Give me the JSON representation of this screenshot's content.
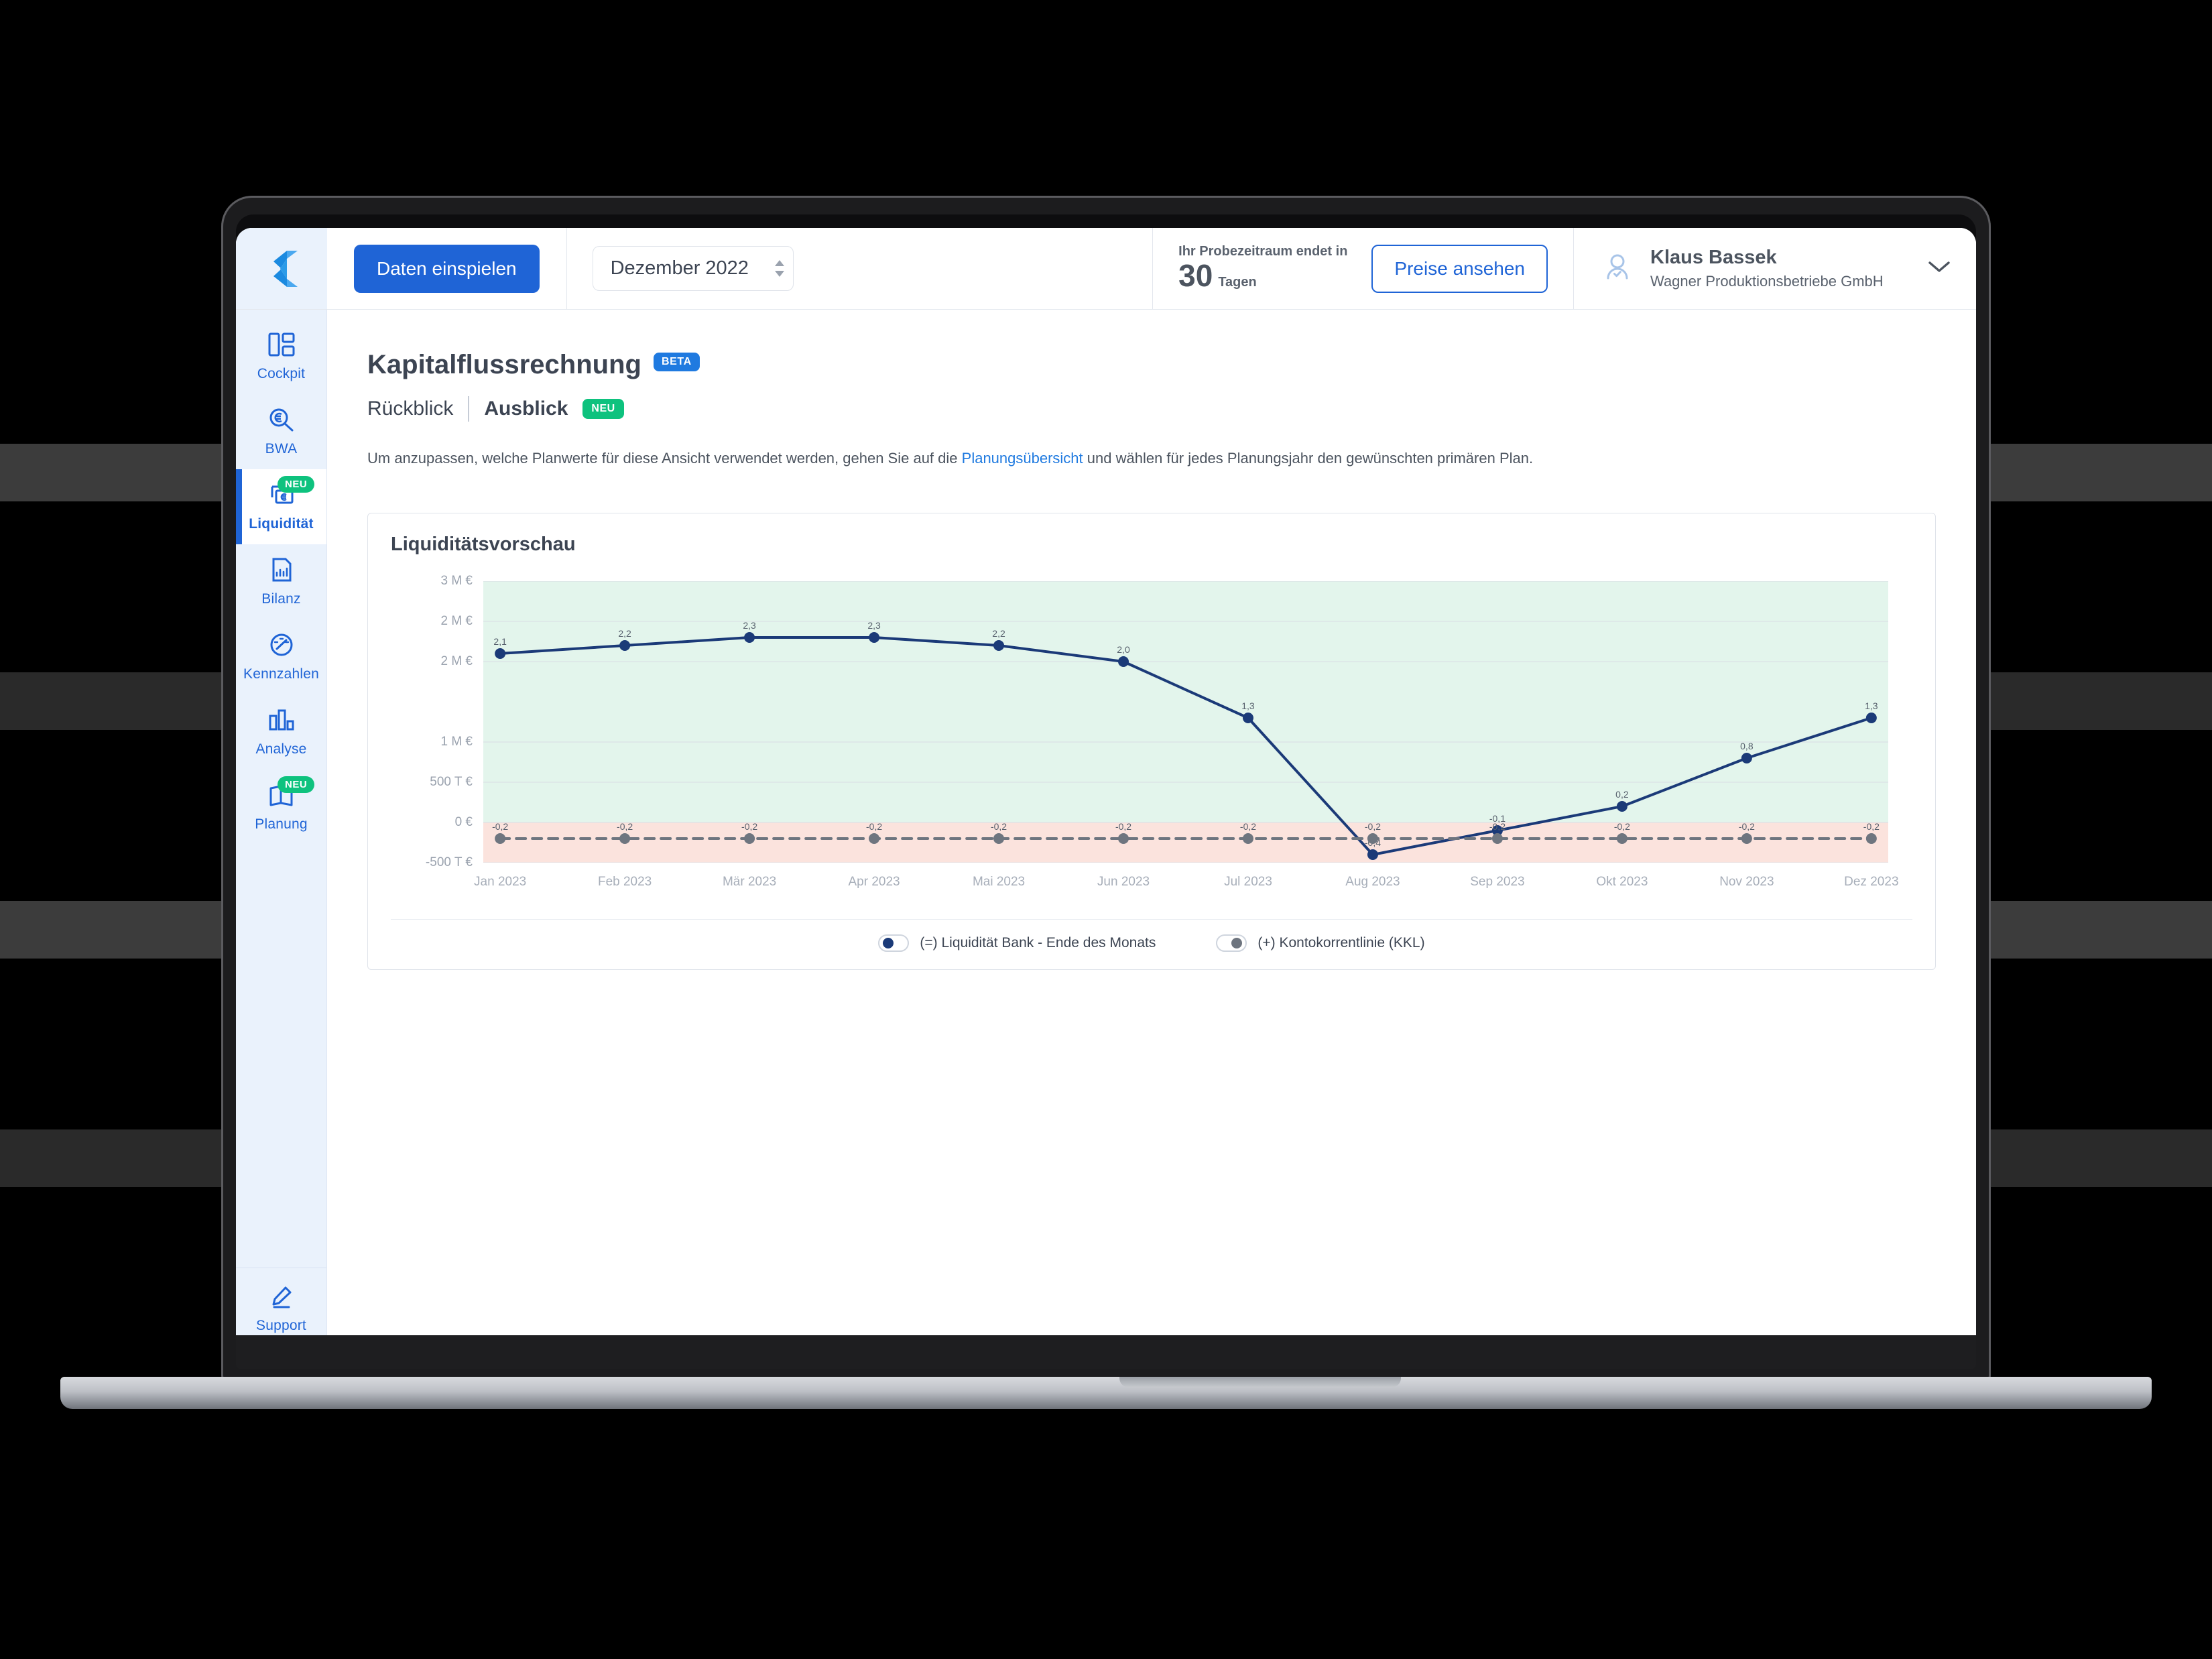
{
  "topbar": {
    "logo_icon": "agicap-logo-icon",
    "import_button": "Daten einspielen",
    "period_value": "Dezember 2022",
    "trial_line1": "Ihr Probezeitraum endet in",
    "trial_days": "30",
    "trial_unit": "Tagen",
    "pricing_button": "Preise ansehen",
    "user_name": "Klaus Bassek",
    "user_org": "Wagner Produktionsbetriebe GmbH",
    "chevron_icon": "chevron-down-icon",
    "avatar_icon": "user-avatar-icon"
  },
  "sidebar": {
    "items": [
      {
        "label": "Cockpit",
        "icon": "dashboard-grid-icon",
        "badge": "",
        "active": false
      },
      {
        "label": "BWA",
        "icon": "magnifier-euro-icon",
        "badge": "",
        "active": false
      },
      {
        "label": "Liquidität",
        "icon": "cash-euro-icon",
        "badge": "NEU",
        "active": true
      },
      {
        "label": "Bilanz",
        "icon": "document-chart-icon",
        "badge": "",
        "active": false
      },
      {
        "label": "Kennzahlen",
        "icon": "speedometer-icon",
        "badge": "",
        "active": false
      },
      {
        "label": "Analyse",
        "icon": "bar-chart-icon",
        "badge": "",
        "active": false
      },
      {
        "label": "Planung",
        "icon": "open-book-icon",
        "badge": "NEU",
        "active": false
      }
    ],
    "support": {
      "label": "Support",
      "icon": "pencil-icon"
    }
  },
  "page": {
    "title": "Kapitalflussrechnung",
    "title_badge": "BETA",
    "tabs": [
      {
        "label": "Rückblick",
        "badge": "",
        "active": false
      },
      {
        "label": "Ausblick",
        "badge": "NEU",
        "active": true
      }
    ],
    "helper_before": "Um anzupassen, welche Planwerte für diese Ansicht verwendet werden, gehen Sie auf die ",
    "helper_link": "Planungsübersicht",
    "helper_after": " und wählen für jedes Planungsjahr den gewünschten primären Plan."
  },
  "card": {
    "title": "Liquiditätsvorschau"
  },
  "legend": [
    {
      "label": "(=) Liquidität Bank - Ende des Monats",
      "state": "on",
      "color": "#1b3a78"
    },
    {
      "label": "(+) Kontokorrentlinie (KKL)",
      "state": "off",
      "color": "#6e757f"
    }
  ],
  "chart_data": {
    "type": "line",
    "title": "Liquiditätsvorschau",
    "xlabel": "",
    "ylabel": "",
    "grid": true,
    "legend_position": "bottom",
    "categories": [
      "Jan 2023",
      "Feb 2023",
      "Mär 2023",
      "Apr 2023",
      "Mai 2023",
      "Jun 2023",
      "Jul 2023",
      "Aug 2023",
      "Sep 2023",
      "Okt 2023",
      "Nov 2023",
      "Dez 2023"
    ],
    "ytick_labels": [
      "3 M €",
      "2 M €",
      "2 M €",
      "1 M €",
      "500 T €",
      "0 €",
      "-500 T €"
    ],
    "ytick_values": [
      3000000,
      2500000,
      2000000,
      1000000,
      500000,
      0,
      -500000
    ],
    "ylim": [
      -500000,
      3000000
    ],
    "unit": "Mio €",
    "bands": [
      {
        "name": "positive-band",
        "from": 0,
        "to": 3000000,
        "color": "#e3f5ec"
      },
      {
        "name": "negative-band",
        "from": -500000,
        "to": 0,
        "color": "#fbe3dd"
      }
    ],
    "series": [
      {
        "name": "(=) Liquidität Bank - Ende des Monats",
        "color": "#1b3a78",
        "style": "solid",
        "labels": [
          "2,1",
          "2,2",
          "2,3",
          "2,3",
          "2,2",
          "2,0",
          "1,3",
          "-0,4",
          "-0,1",
          "0,2",
          "0,8",
          "1,3"
        ],
        "values": [
          2100000,
          2200000,
          2300000,
          2300000,
          2200000,
          2000000,
          1300000,
          -400000,
          -100000,
          200000,
          800000,
          1300000
        ]
      },
      {
        "name": "(+) Kontokorrentlinie (KKL)",
        "color": "#6e757f",
        "style": "dashed",
        "labels": [
          "-0,2",
          "-0,2",
          "-0,2",
          "-0,2",
          "-0,2",
          "-0,2",
          "-0,2",
          "-0,2",
          "-0,2",
          "-0,2",
          "-0,2",
          "-0,2"
        ],
        "values": [
          -200000,
          -200000,
          -200000,
          -200000,
          -200000,
          -200000,
          -200000,
          -200000,
          -200000,
          -200000,
          -200000,
          -200000
        ]
      }
    ]
  }
}
